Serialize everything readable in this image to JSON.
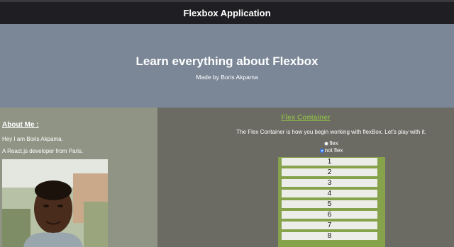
{
  "header": {
    "title": "Flexbox Application"
  },
  "hero": {
    "title": "Learn everything about Flexbox",
    "subtitle": "Made by Boris Akpama"
  },
  "about": {
    "heading": "About Me :",
    "line1": "Hey I am Boris Akpama.",
    "line2": "A React.js developer from Paris."
  },
  "flex_section": {
    "title": "Flex Container",
    "description": "The Flex Container is how you begin working with flexBox. Let's play with it.",
    "radio_options": [
      {
        "label": "flex",
        "selected": false
      },
      {
        "label": "not flex",
        "selected": true
      }
    ],
    "items": [
      "1",
      "2",
      "3",
      "4",
      "5",
      "6",
      "7",
      "8"
    ]
  },
  "colors": {
    "topbar": "#1f1e22",
    "hero": "#7b8797",
    "left_panel": "#8f9484",
    "right_panel": "#6b6a63",
    "accent_green": "#8ab14d",
    "container_green": "#86a24b",
    "radio_selected": "#3478f6"
  }
}
